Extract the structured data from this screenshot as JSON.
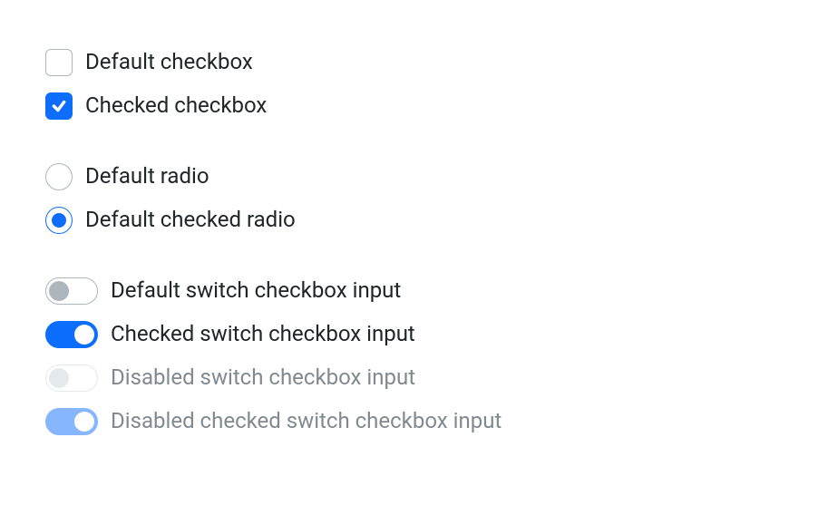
{
  "checkboxes": [
    {
      "label": "Default checkbox",
      "checked": false
    },
    {
      "label": "Checked checkbox",
      "checked": true
    }
  ],
  "radios": [
    {
      "label": "Default radio",
      "checked": false
    },
    {
      "label": "Default checked radio",
      "checked": true
    }
  ],
  "switches": [
    {
      "label": "Default switch checkbox input",
      "checked": false,
      "disabled": false
    },
    {
      "label": "Checked switch checkbox input",
      "checked": true,
      "disabled": false
    },
    {
      "label": "Disabled switch checkbox input",
      "checked": false,
      "disabled": true
    },
    {
      "label": "Disabled checked switch checkbox input",
      "checked": true,
      "disabled": true
    }
  ]
}
